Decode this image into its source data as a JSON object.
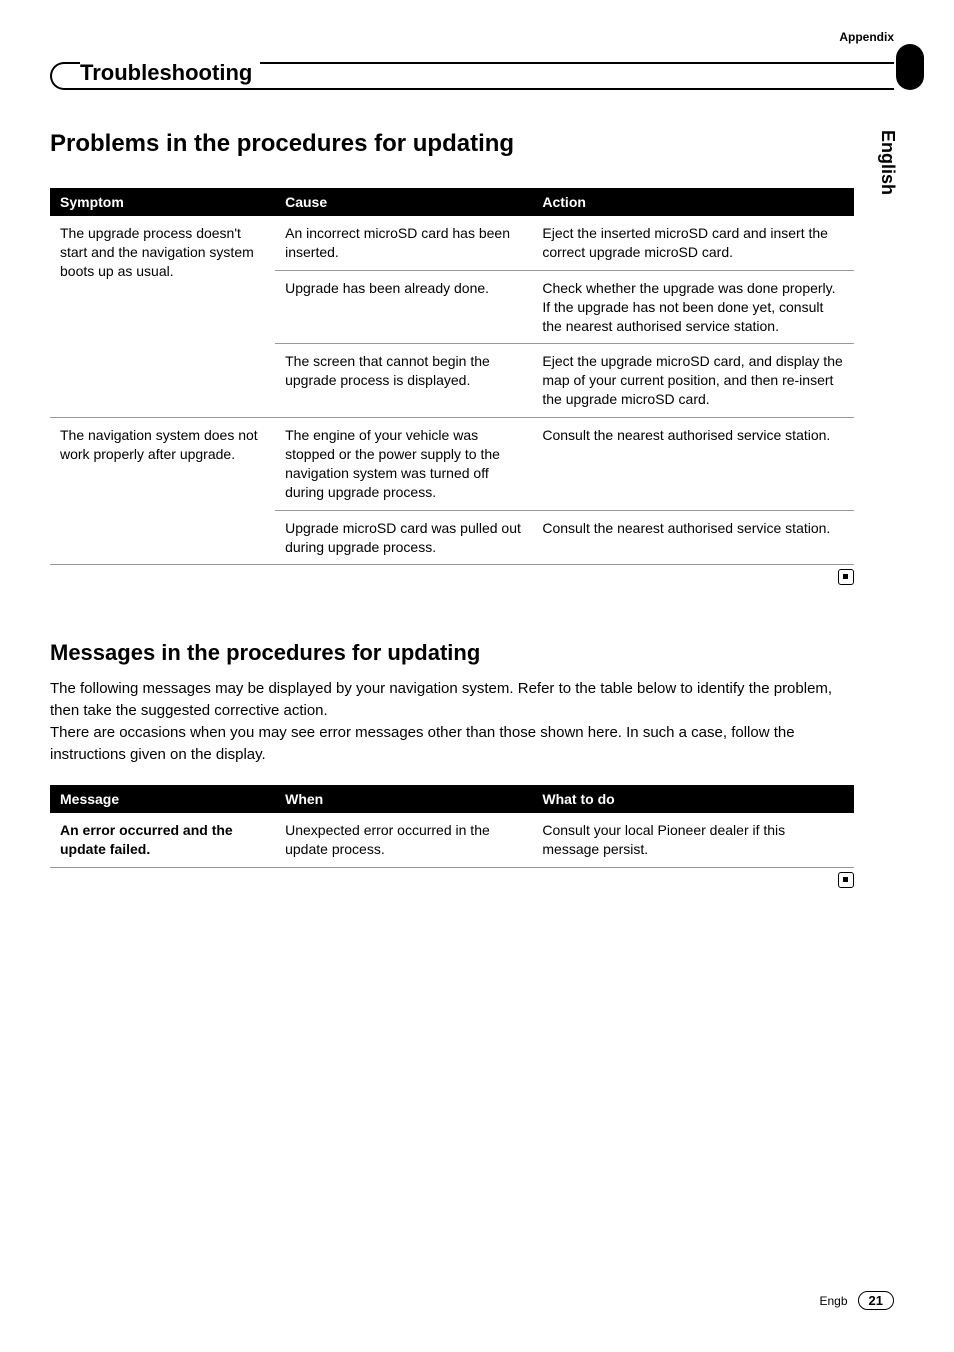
{
  "header": {
    "appendix_label": "Appendix",
    "section_title": "Troubleshooting",
    "language": "English"
  },
  "section1": {
    "heading": "Problems in the procedures for updating",
    "table": {
      "headers": [
        "Symptom",
        "Cause",
        "Action"
      ],
      "rows": [
        {
          "symptom": "The upgrade process doesn't start and the navigation system boots up as usual.",
          "symptom_rowspan": 3,
          "cause": "An incorrect microSD card has been inserted.",
          "action": "Eject the inserted microSD card and insert the correct upgrade microSD card."
        },
        {
          "cause": "Upgrade has been already done.",
          "action": "Check whether the upgrade was done properly. If the upgrade has not been done yet, consult the nearest authorised service station."
        },
        {
          "cause": "The screen that cannot begin the upgrade process is displayed.",
          "action": "Eject the upgrade microSD card, and display the map of your current position, and then re-insert the upgrade microSD card."
        },
        {
          "symptom": "The navigation system does not work properly after upgrade.",
          "symptom_rowspan": 2,
          "cause": "The engine of your vehicle was stopped or the power supply to the navigation system was turned off during upgrade process.",
          "action": "Consult the nearest authorised service station."
        },
        {
          "cause": "Upgrade microSD card was pulled out during upgrade process.",
          "action": "Consult the nearest authorised service station."
        }
      ]
    }
  },
  "section2": {
    "heading": "Messages in the procedures for updating",
    "intro_p1": "The following messages may be displayed by your navigation system. Refer to the table below to identify the problem, then take the suggested corrective action.",
    "intro_p2": "There are occasions when you may see error messages other than those shown here. In such a case, follow the instructions given on the display.",
    "table": {
      "headers": [
        "Message",
        "When",
        "What to do"
      ],
      "rows": [
        {
          "message": "An error occurred and the update failed.",
          "when": "Unexpected error occurred in the update process.",
          "action": "Consult your local Pioneer dealer if this message persist."
        }
      ]
    }
  },
  "footer": {
    "lang_code": "Engb",
    "page_number": "21"
  }
}
